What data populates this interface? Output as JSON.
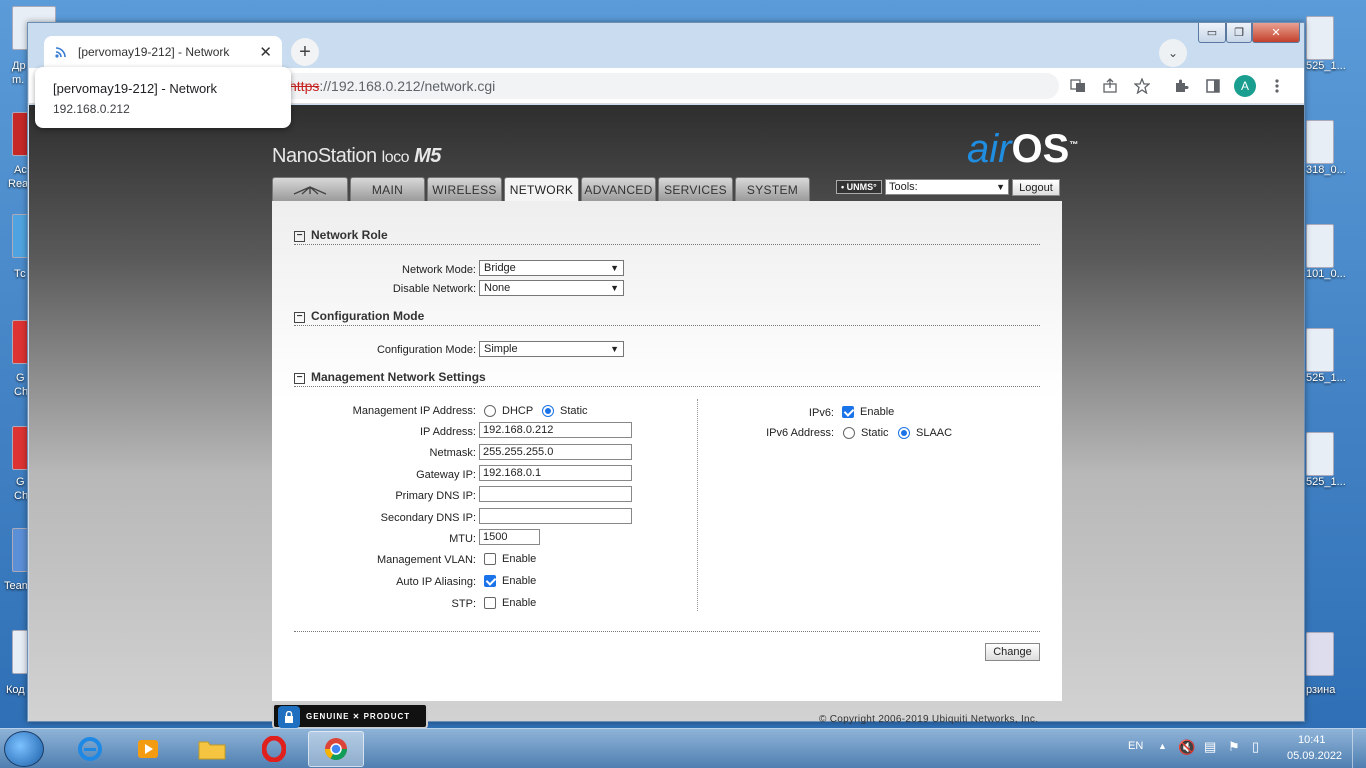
{
  "desktop": {
    "left_labels": [
      "Др",
      "m.",
      "Ac",
      "Rea",
      "Тс",
      "G",
      "Ch",
      "G",
      "Ch",
      "Team",
      "Код"
    ],
    "right_labels": [
      "525_1...",
      "318_0...",
      "101_0...",
      "525_1...",
      "525_1...",
      "рзина"
    ]
  },
  "browser": {
    "tab": {
      "title": "[pervomay19-212] - Network",
      "close": "✕"
    },
    "new_tab": "+",
    "tab_search": "⌄",
    "window_controls": {
      "minimize": "▭",
      "restore": "❐",
      "close": "✕"
    },
    "address": {
      "scheme": "https",
      "rest_host": "://192.168.0.212",
      "path": "/network.cgi"
    },
    "avatar_letter": "A",
    "tooltip": {
      "title": "[pervomay19-212] - Network",
      "url": "192.168.0.212"
    }
  },
  "header": {
    "product": "NanoStation",
    "product_sub": "loco",
    "model": "M5",
    "logo_air": "air",
    "logo_os": "OS",
    "logo_tm": "™"
  },
  "nav": {
    "tabs": [
      {
        "label": "",
        "name": "logo"
      },
      {
        "label": "MAIN",
        "name": "main"
      },
      {
        "label": "WIRELESS",
        "name": "wireless"
      },
      {
        "label": "NETWORK",
        "name": "network",
        "active": true
      },
      {
        "label": "ADVANCED",
        "name": "advanced"
      },
      {
        "label": "SERVICES",
        "name": "services"
      },
      {
        "label": "SYSTEM",
        "name": "system"
      }
    ],
    "unms": "• UNMS°",
    "tools_label": "Tools:",
    "logout": "Logout"
  },
  "network_role": {
    "heading": "Network Role",
    "mode_label": "Network Mode:",
    "mode_value": "Bridge",
    "disable_label": "Disable Network:",
    "disable_value": "None"
  },
  "config_mode": {
    "heading": "Configuration Mode",
    "label": "Configuration Mode:",
    "value": "Simple"
  },
  "management": {
    "heading": "Management Network Settings",
    "ip_mode_label": "Management IP Address:",
    "dhcp": "DHCP",
    "static": "Static",
    "ip_label": "IP Address:",
    "ip": "192.168.0.212",
    "netmask_label": "Netmask:",
    "netmask": "255.255.255.0",
    "gateway_label": "Gateway IP:",
    "gateway": "192.168.0.1",
    "dns1_label": "Primary DNS IP:",
    "dns1": "",
    "dns2_label": "Secondary DNS IP:",
    "dns2": "",
    "mtu_label": "MTU:",
    "mtu": "1500",
    "vlan_label": "Management VLAN:",
    "alias_label": "Auto IP Aliasing:",
    "stp_label": "STP:",
    "enable": "Enable",
    "ipv6_label": "IPv6:",
    "ipv6_addr_label": "IPv6 Address:",
    "ipv6_static": "Static",
    "ipv6_slaac": "SLAAC"
  },
  "actions": {
    "change": "Change"
  },
  "footer": {
    "genuine": "GENUINE ✕ PRODUCT",
    "copyright": "© Copyright 2006-2019 Ubiquiti Networks, Inc."
  },
  "taskbar": {
    "lang": "EN",
    "time": "10:41",
    "date": "05.09.2022"
  },
  "colors": {
    "accent": "#1a73e8",
    "airos_blue": "#1f8de0"
  }
}
